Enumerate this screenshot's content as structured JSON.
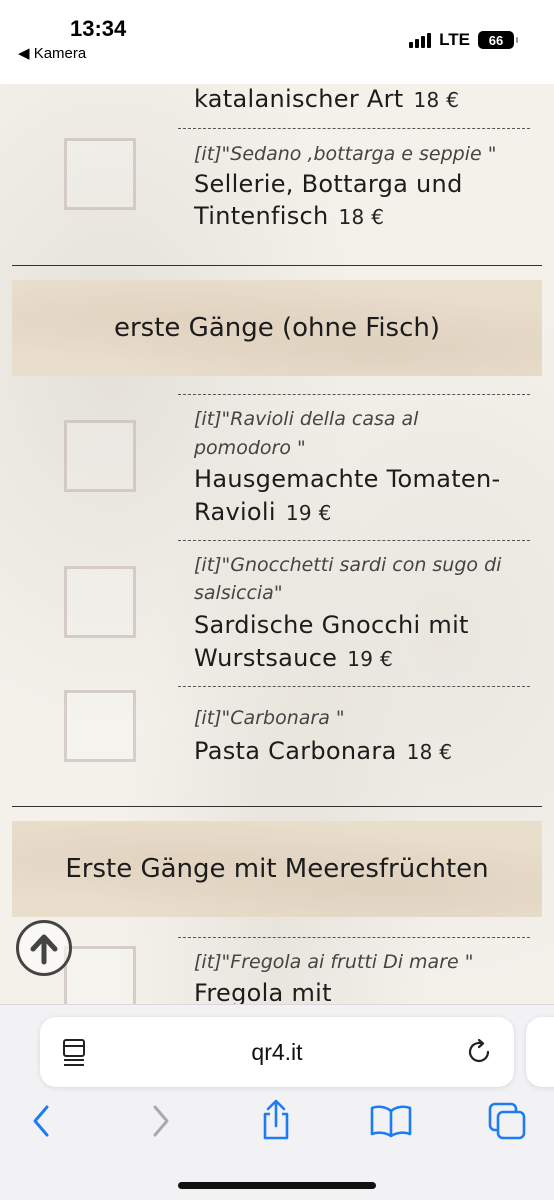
{
  "status_bar": {
    "time": "13:34",
    "back_label": "◀ Kamera",
    "network": "LTE",
    "battery": "66"
  },
  "menu": {
    "top_partial": {
      "de_name": "katalanischer Art",
      "price": "18 €"
    },
    "item_sedano": {
      "it_name": "[it]\"Sedano ,bottarga e seppie \"",
      "de_line1": "Sellerie, Bottarga und",
      "de_line2": "Tintenfisch",
      "price": "18 €"
    },
    "section_1": "erste Gänge (ohne Fisch)",
    "item_ravioli": {
      "it_line1": "[it]\"Ravioli della casa al",
      "it_line2": "pomodoro \"",
      "de_line1": "Hausgemachte Tomaten-",
      "de_line2": "Ravioli",
      "price": "19 €"
    },
    "item_gnocchetti": {
      "it_line1": "[it]\"Gnocchetti sardi con sugo di",
      "it_line2": "salsiccia\"",
      "de_line1": "Sardische Gnocchi mit",
      "de_line2": "Wurstsauce",
      "price": "19 €"
    },
    "item_carbonara": {
      "it_name": "[it]\"Carbonara \"",
      "de_name": "Pasta Carbonara",
      "price": "18 €"
    },
    "section_2": "Erste Gänge mit Meeresfrüchten",
    "item_fregola": {
      "it_name": "[it]\"Fregola ai frutti Di mare \"",
      "de_line1": "Fregola mit"
    }
  },
  "browser": {
    "url": "qr4.it"
  },
  "icons": {
    "scroll_top": "arrow-up-circle-icon",
    "reader": "reader-mode-icon",
    "reload": "reload-icon",
    "back": "chevron-left-icon",
    "forward": "chevron-right-icon",
    "share": "share-icon",
    "bookmarks": "book-icon",
    "tabs": "tabs-icon"
  },
  "colors": {
    "accent": "#1e7cf2",
    "section_bg": "#e9ddcc"
  }
}
